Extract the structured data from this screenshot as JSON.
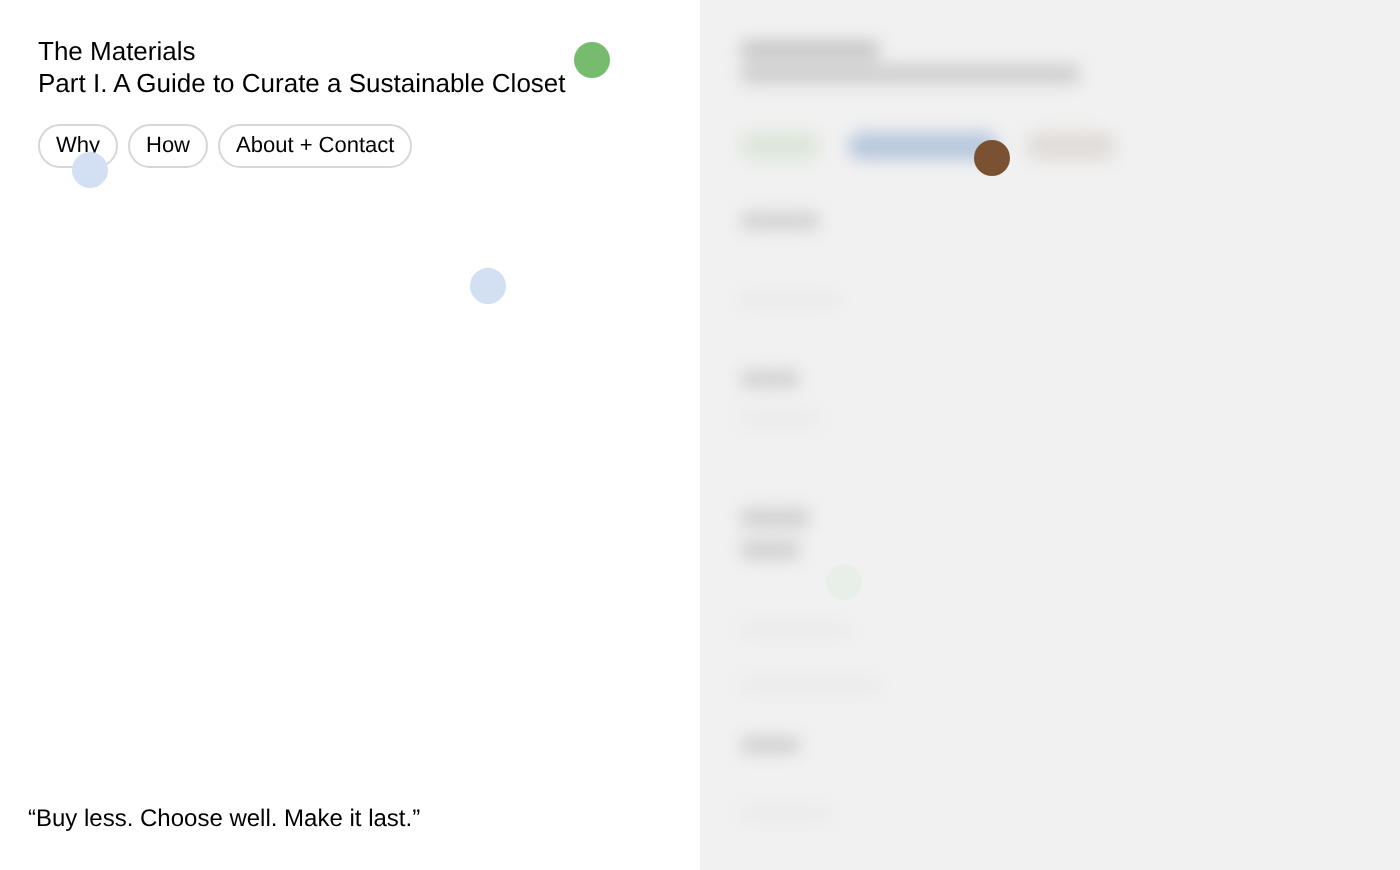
{
  "header": {
    "title": "The Materials",
    "subtitle": "Part I. A Guide to Curate a Sustainable Closet"
  },
  "nav": [
    {
      "label": "Why"
    },
    {
      "label": "How"
    },
    {
      "label": "About + Contact"
    }
  ],
  "quote": "“Buy less. Choose well. Make it last.”",
  "dots": [
    {
      "color": "#77bb6e"
    },
    {
      "color": "#d3e0f3"
    },
    {
      "color": "#d3e0f3"
    },
    {
      "color": "#7a5232"
    },
    {
      "color": "#e8efe8"
    }
  ]
}
